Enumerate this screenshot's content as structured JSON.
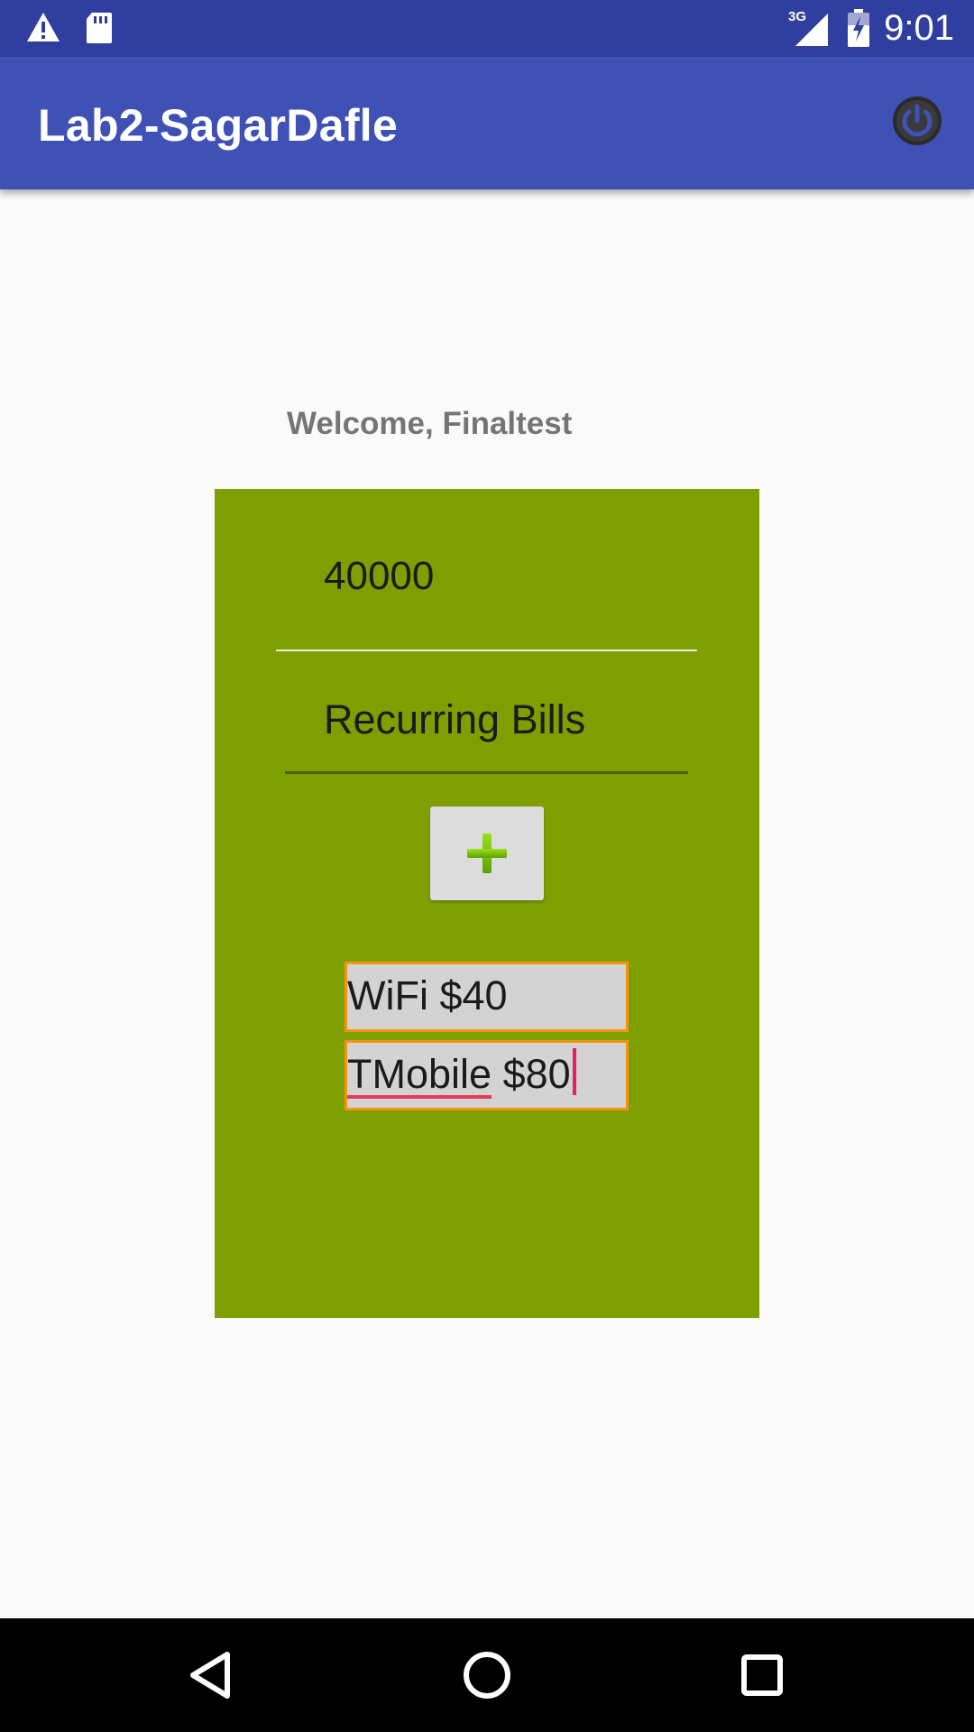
{
  "status_bar": {
    "time": "9:01",
    "network": "3G",
    "icons": [
      "warning-icon",
      "sd-card-icon",
      "signal-icon",
      "battery-charging-icon"
    ]
  },
  "app_bar": {
    "title": "Lab2-SagarDafle",
    "action_icon": "power-icon"
  },
  "welcome_text": "Welcome, Finaltest",
  "income": {
    "value": "40000"
  },
  "bills": {
    "header": "Recurring Bills",
    "add_icon": "plus-icon",
    "items": [
      {
        "label": "WiFi $40"
      },
      {
        "label_part1": "TMobile",
        "label_part2": " $80"
      }
    ]
  },
  "colors": {
    "status_bar": "#303f9f",
    "app_bar": "#3f51b5",
    "card": "#7f9f00",
    "item_border": "#f29410",
    "cursor": "#e91e63"
  },
  "nav_bar": {
    "icons": [
      "back-icon",
      "home-icon",
      "recents-icon"
    ]
  }
}
